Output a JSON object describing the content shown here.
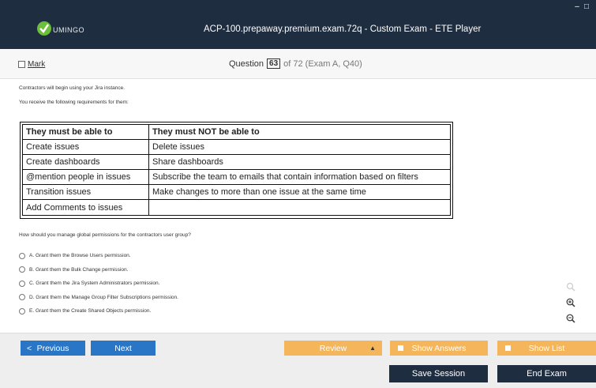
{
  "titlebar": {
    "logo_text": "UMINGO",
    "title": "ACP-100.prepaway.premium.exam.72q - Custom Exam - ETE Player",
    "window_controls": [
      "–",
      "□"
    ]
  },
  "header": {
    "mark_label": "Mark",
    "question_label": "Question",
    "question_number": "63",
    "question_of": "of 72 (Exam A, Q40)"
  },
  "content": {
    "intro_lines": [
      "Contractors will begin using your Jira instance.",
      "You receive the following requirements for them:"
    ],
    "table": {
      "headers": [
        "They must be able to",
        "They must NOT be able to"
      ],
      "rows": [
        [
          "Create issues",
          "Delete issues"
        ],
        [
          "Create dashboards",
          "Share dashboards"
        ],
        [
          "@mention people in issues",
          "Subscribe the team to emails that contain information based on filters"
        ],
        [
          "Transition issues",
          "Make changes to more than one issue at the same time"
        ],
        [
          "Add Comments to issues",
          ""
        ]
      ]
    },
    "question": "How should you manage global permissions for the contractors user group?",
    "options": [
      "A.  Grant them the Browse Users permission.",
      "B.  Grant them the Bulk Change permission.",
      "C.  Grant them the Jira System Administrators permission.",
      "D.  Grant them the Manage Group Filter Subscriptions permission.",
      "E.  Grant them the Create Shared Objects permission."
    ]
  },
  "nav": {
    "previous_label": "Previous",
    "previous_arrow": "<",
    "next_label": "Next",
    "review_label": "Review",
    "review_caret": "▲",
    "show_answers_label": "Show Answers",
    "show_list_label": "Show List"
  },
  "footer": {
    "save_session_label": "Save Session",
    "end_exam_label": "End Exam"
  },
  "icons": {
    "zoom_search": "search-icon",
    "zoom_in": "zoom-in-icon",
    "zoom_out": "zoom-out-icon"
  },
  "colors": {
    "titlebar": "#1f2d40",
    "nav_blue": "#2a76c6",
    "nav_orange": "#f5b55a",
    "logo_green": "#6bbf3b"
  }
}
